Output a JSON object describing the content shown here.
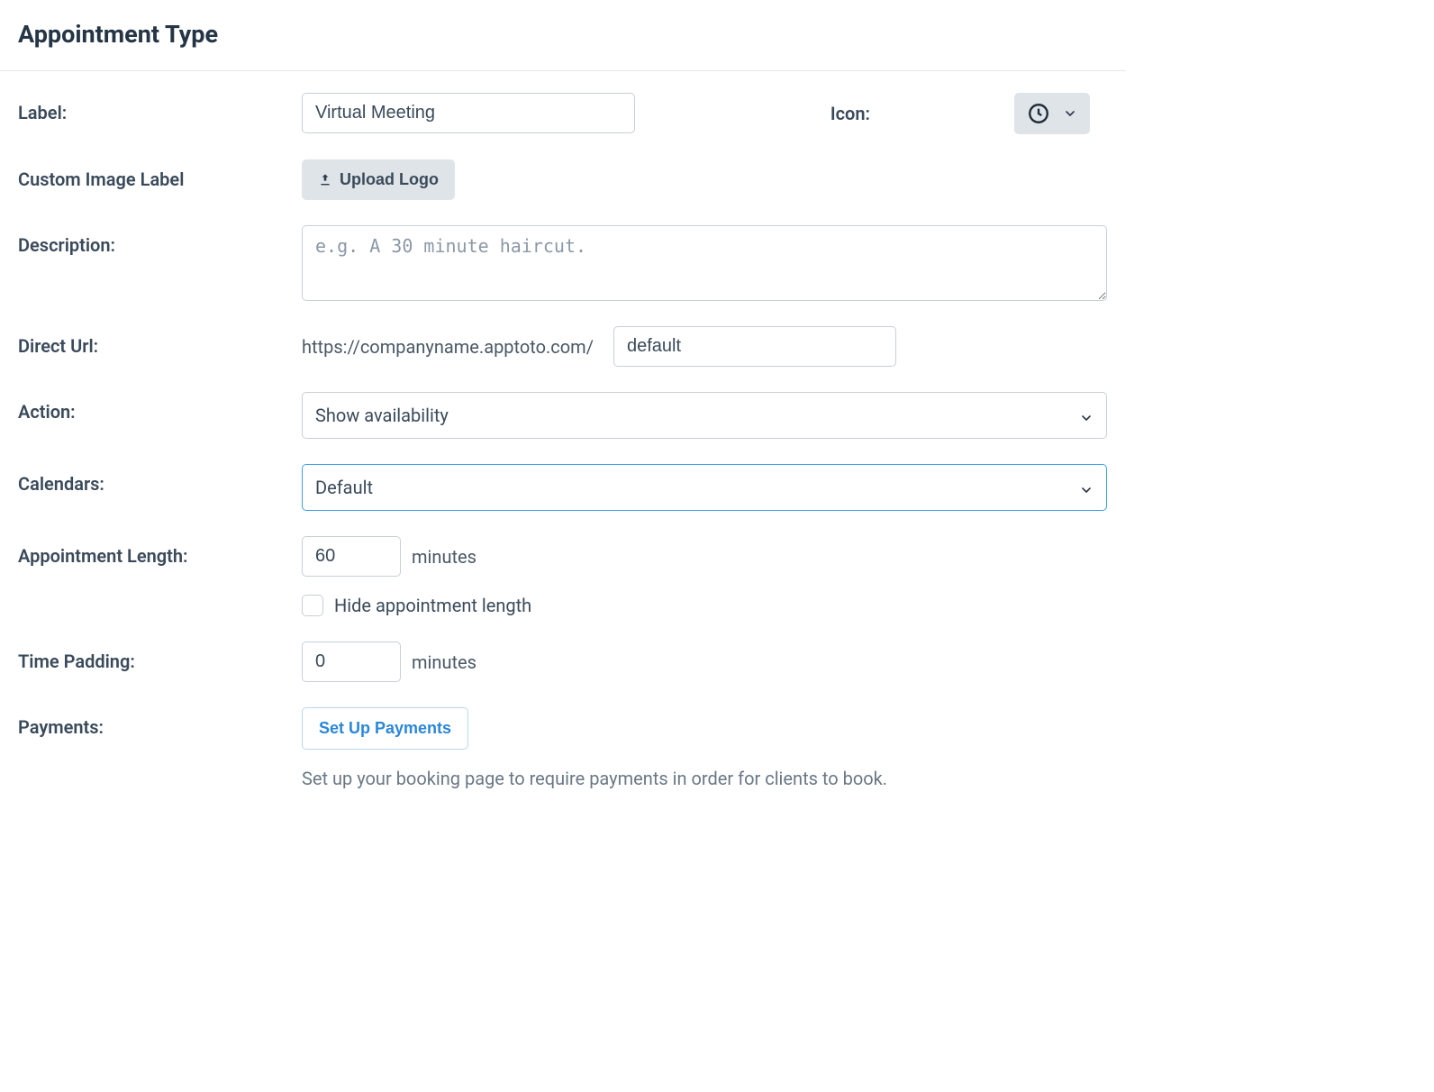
{
  "header": {
    "title": "Appointment Type"
  },
  "labels": {
    "label": "Label:",
    "icon": "Icon:",
    "custom_image": "Custom Image Label",
    "description": "Description:",
    "direct_url": "Direct Url:",
    "action": "Action:",
    "calendars": "Calendars:",
    "appointment_length": "Appointment Length:",
    "time_padding": "Time Padding:",
    "payments": "Payments:"
  },
  "values": {
    "label_input": "Virtual Meeting",
    "description_placeholder": "e.g. A 30 minute haircut.",
    "url_prefix": "https://companyname.apptoto.com/",
    "url_slug": "default",
    "action_selected": "Show availability",
    "calendars_selected": "Default",
    "appointment_length": "60",
    "time_padding": "0",
    "minutes_suffix": "minutes",
    "hide_length_label": "Hide appointment length",
    "payments_help": "Set up your booking page to require payments in order for clients to book."
  },
  "buttons": {
    "upload_logo": "Upload Logo",
    "setup_payments": "Set Up Payments"
  },
  "icons": {
    "selected_icon": "clock-icon"
  }
}
